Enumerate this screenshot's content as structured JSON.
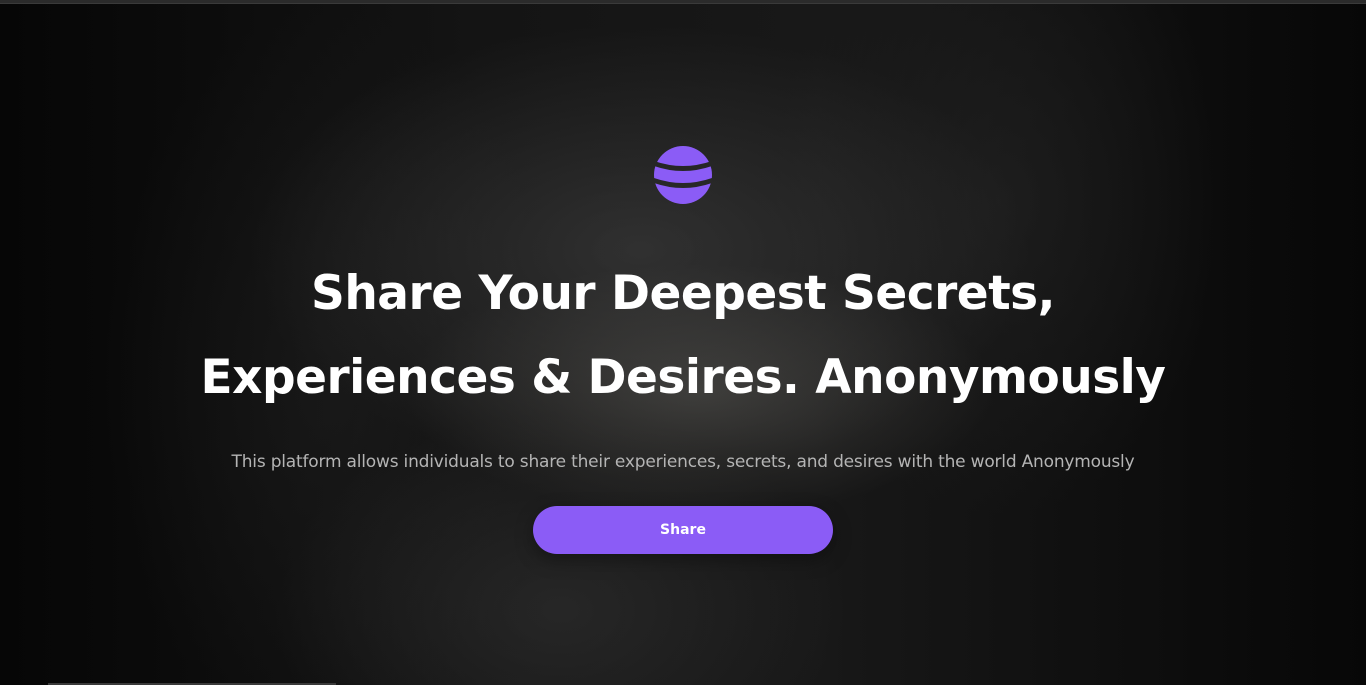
{
  "hero": {
    "logo": {
      "icon": "striped-globe-icon",
      "color": "#8b5cf6"
    },
    "headline_line1": "Share Your Deepest Secrets,",
    "headline_line2": "Experiences & Desires. Anonymously",
    "subtext": "This platform allows individuals to share their experiences, secrets, and desires with the world Anonymously",
    "share_label": "Share"
  },
  "colors": {
    "accent": "#8b5cf6",
    "headline": "#ffffff",
    "subtext": "#b4b4b4"
  }
}
